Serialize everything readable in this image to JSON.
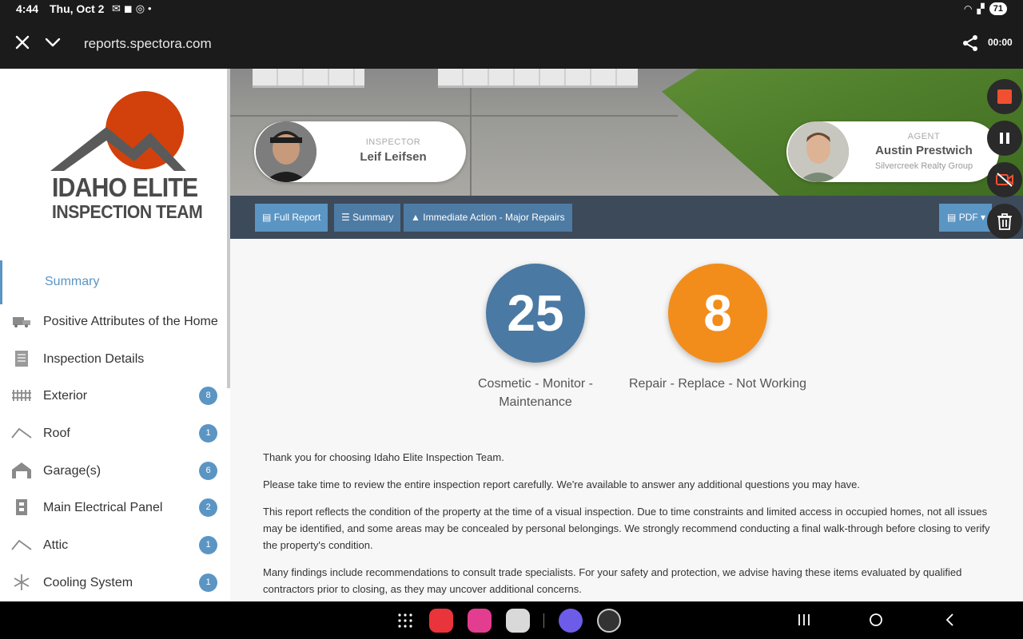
{
  "status_bar": {
    "time": "4:44",
    "date": "Thu, Oct 2",
    "battery": "71"
  },
  "browser": {
    "url": "reports.spectora.com",
    "recording_timer": "00:00"
  },
  "logo": {
    "line1": "IDAHO ELITE",
    "line2": "INSPECTION TEAM"
  },
  "sidebar": {
    "summary_label": "Summary",
    "items": [
      {
        "label": "Positive Attributes of the Home",
        "icon": "home-value-icon",
        "badge": ""
      },
      {
        "label": "Inspection Details",
        "icon": "document-icon",
        "badge": ""
      },
      {
        "label": "Exterior",
        "icon": "fence-icon",
        "badge": "8"
      },
      {
        "label": "Roof",
        "icon": "roof-icon",
        "badge": "1"
      },
      {
        "label": "Garage(s)",
        "icon": "garage-icon",
        "badge": "6"
      },
      {
        "label": "Main Electrical Panel",
        "icon": "electrical-panel-icon",
        "badge": "2"
      },
      {
        "label": "Attic",
        "icon": "attic-icon",
        "badge": "1"
      },
      {
        "label": "Cooling System",
        "icon": "snowflake-icon",
        "badge": "1"
      }
    ]
  },
  "inspector": {
    "role": "INSPECTOR",
    "name": "Leif Leifsen"
  },
  "agent": {
    "role": "AGENT",
    "name": "Austin Prestwich",
    "org": "Silvercreek Realty Group"
  },
  "toolbar": {
    "full_report": "Full Report",
    "summary": "Summary",
    "immediate_action": "Immediate Action - Major Repairs",
    "pdf": "PDF"
  },
  "counts": {
    "cosmetic": {
      "value": "25",
      "label": "Cosmetic - Monitor - Maintenance",
      "color": "#4a7aa4"
    },
    "repair": {
      "value": "8",
      "label": "Repair - Replace - Not Working",
      "color": "#f28c1a"
    }
  },
  "intro": {
    "p1": "Thank you for choosing Idaho Elite Inspection Team.",
    "p2": "Please take time to review the entire inspection report carefully. We're available to answer any additional questions you may have.",
    "p3": "This report reflects the condition of the property at the time of a visual inspection. Due to time constraints and limited access in occupied homes, not all issues may be identified, and some areas may be concealed by personal belongings. We strongly recommend conducting a final walk-through before closing to verify the property's condition.",
    "p4": "Many findings include recommendations to consult trade specialists. For your safety and protection, we advise having these items evaluated by qualified contractors prior to closing, as they may uncover additional concerns."
  },
  "colors": {
    "accent": "#5b95c4",
    "toolbar_bg": "#3d4a5a",
    "logo_sun": "#d2410c"
  }
}
